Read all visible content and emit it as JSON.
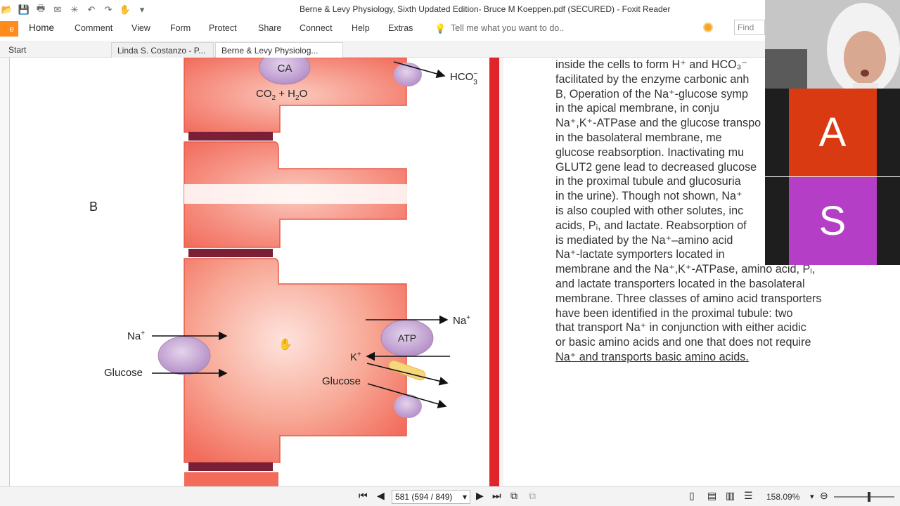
{
  "window": {
    "title": "Berne & Levy Physiology, Sixth Updated Edition- Bruce M Koeppen.pdf (SECURED) - Foxit Reader"
  },
  "menu": {
    "file_label": "e",
    "items": [
      "Home",
      "Comment",
      "View",
      "Form",
      "Protect",
      "Share",
      "Connect",
      "Help",
      "Extras"
    ],
    "tell_me": "Tell me what you want to do..",
    "find_placeholder": "Find"
  },
  "tabs": [
    {
      "label": "Start"
    },
    {
      "label": "Linda S. Costanzo - P..."
    },
    {
      "label": "Berne & Levy Physiolog...",
      "active": true
    }
  ],
  "figure": {
    "panel_label": "B",
    "ca_label": "CA",
    "co2_h2o": "CO",
    "hco3": "HCO",
    "atp_label": "ATP",
    "na_left": "Na",
    "glucose_left": "Glucose",
    "na_right": "Na",
    "k_right": "K",
    "glucose_right": "Glucose",
    "colors": {
      "cell": "#f26b5b",
      "junction": "#7a1f35",
      "transporter": "#c9a3d6",
      "redline": "#e0242a"
    }
  },
  "text_lines": [
    "inside the cells to form H⁺ and HCO₃⁻",
    "facilitated by the enzyme carbonic anh",
    "B, Operation of the Na⁺-glucose symp",
    "in the apical membrane, in conju",
    "Na⁺,K⁺-ATPase and the glucose transpo",
    "in the basolateral membrane, me",
    "glucose reabsorption. Inactivating mu",
    "GLUT2 gene lead to decreased glucose",
    "in the proximal tubule and glucosuria",
    "in the urine). Though not shown, Na⁺",
    "is also coupled with other solutes, inc",
    "acids, Pᵢ, and lactate. Reabsorption of",
    "is mediated by the Na⁺–amino acid",
    "Na⁺-lactate symporters located in",
    "membrane and the Na⁺,K⁺-ATPase, amino acid, Pᵢ,",
    "and lactate transporters located in the basolateral",
    "membrane. Three classes of amino acid transporters",
    "have been identified in the proximal tubule: two",
    "that transport Na⁺ in conjunction with either acidic",
    "or basic amino acids and one that does not require",
    "Na⁺ and transports basic amino acids."
  ],
  "participants": [
    {
      "initial": "A",
      "color": "#d93a12"
    },
    {
      "initial": "S",
      "color": "#b43ec6"
    }
  ],
  "statusbar": {
    "page_text": "581 (594 / 849)",
    "zoom": "158.09%"
  }
}
